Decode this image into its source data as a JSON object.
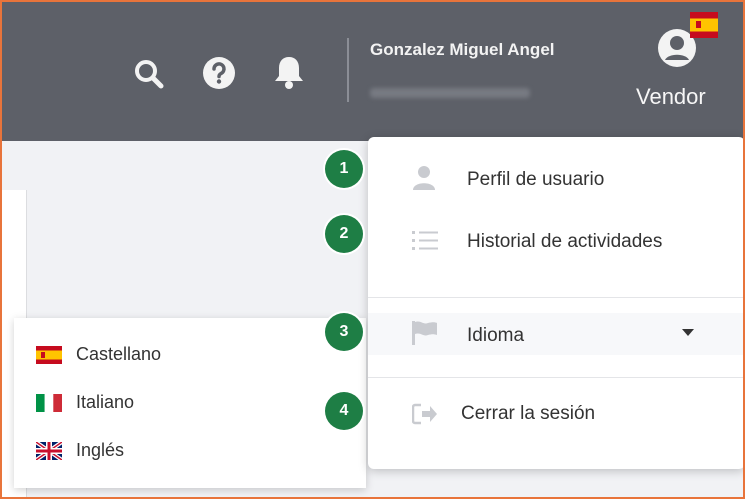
{
  "header": {
    "user_name": "Gonzalez Miguel Angel",
    "role": "Vendor",
    "icons": [
      "search-icon",
      "help-icon",
      "bell-icon",
      "user-avatar-icon",
      "spain-flag-icon"
    ]
  },
  "user_menu": {
    "items": [
      {
        "label": "Perfil de usuario",
        "icon": "user-icon"
      },
      {
        "label": "Historial de actividades",
        "icon": "list-icon"
      },
      {
        "label": "Idioma",
        "icon": "flag-icon"
      },
      {
        "label": "Cerrar la sesión",
        "icon": "logout-icon"
      }
    ]
  },
  "language_menu": {
    "items": [
      {
        "label": "Castellano",
        "icon": "spain-flag-icon"
      },
      {
        "label": "Italiano",
        "icon": "italy-flag-icon"
      },
      {
        "label": "Inglés",
        "icon": "uk-flag-icon"
      }
    ]
  },
  "callouts": [
    "1",
    "2",
    "3",
    "4"
  ],
  "colors": {
    "header_bg": "#5d6068",
    "callout_green": "#1e7e45",
    "frame_border": "#e8743b"
  }
}
